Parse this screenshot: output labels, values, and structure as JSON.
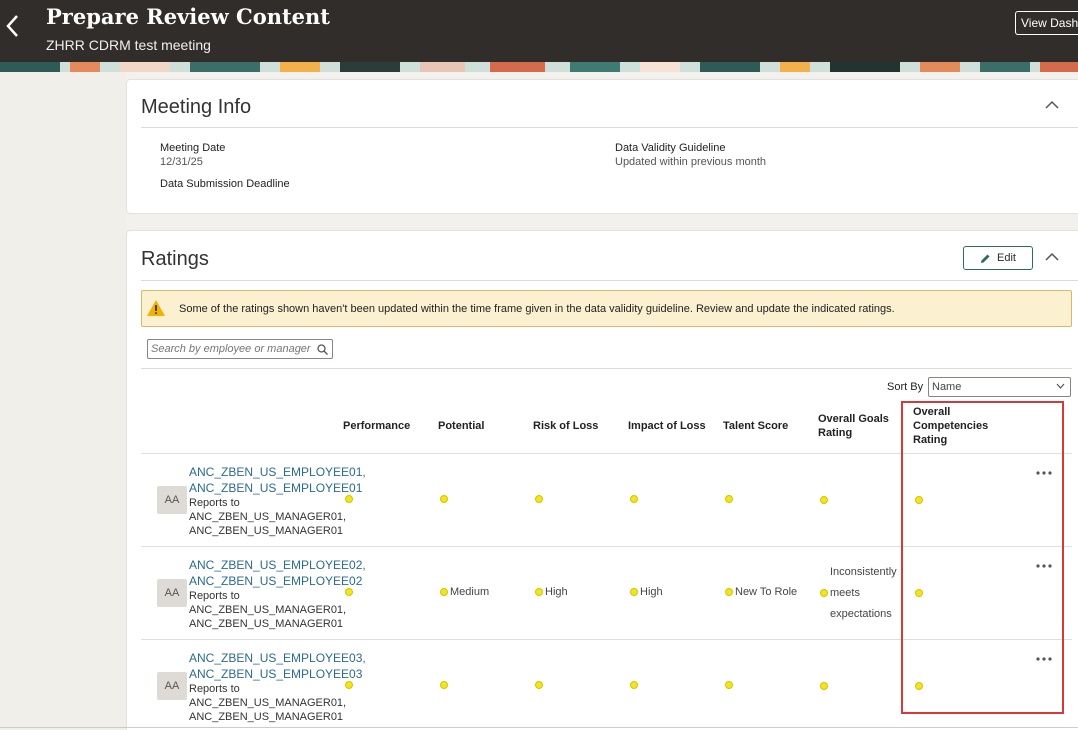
{
  "header": {
    "title": "Prepare Review Content",
    "subtitle": "ZHRR CDRM test meeting",
    "view_dashboard_label": "View Dashb"
  },
  "meeting_info": {
    "title": "Meeting Info",
    "meeting_date_label": "Meeting Date",
    "meeting_date_value": "12/31/25",
    "submission_deadline_label": "Data Submission Deadline",
    "validity_label": "Data Validity Guideline",
    "validity_value": "Updated within previous month"
  },
  "ratings": {
    "title": "Ratings",
    "edit_label": "Edit",
    "warning": "Some of the ratings shown haven't been updated within the time frame given in the data validity guideline. Review and update the indicated ratings.",
    "search_placeholder": "Search by employee or manager",
    "sort_by_label": "Sort By",
    "sort_value": "Name",
    "columns": {
      "performance": "Performance",
      "potential": "Potential",
      "risk_of_loss": "Risk of Loss",
      "impact_of_loss": "Impact of Loss",
      "talent_score": "Talent Score",
      "goals_line1": "Overall Goals",
      "goals_line2": "Rating",
      "comp_line1": "Overall",
      "comp_line2": "Competencies",
      "comp_line3": "Rating"
    },
    "rows": [
      {
        "avatar": "AA",
        "name_line1": "ANC_ZBEN_US_EMPLOYEE01,",
        "name_line2": "ANC_ZBEN_US_EMPLOYEE01",
        "reports_line1": "Reports to",
        "reports_line2": "ANC_ZBEN_US_MANAGER01,",
        "reports_line3": "ANC_ZBEN_US_MANAGER01",
        "potential": "",
        "risk": "",
        "impact": "",
        "talent": ""
      },
      {
        "avatar": "AA",
        "name_line1": "ANC_ZBEN_US_EMPLOYEE02,",
        "name_line2": "ANC_ZBEN_US_EMPLOYEE02",
        "reports_line1": "Reports to",
        "reports_line2": "ANC_ZBEN_US_MANAGER01,",
        "reports_line3": "ANC_ZBEN_US_MANAGER01",
        "potential": "Medium",
        "risk": "High",
        "impact": "High",
        "talent": "New To Role",
        "goals_line1": "Inconsistently",
        "goals_line2": "meets",
        "goals_line3": "expectations"
      },
      {
        "avatar": "AA",
        "name_line1": "ANC_ZBEN_US_EMPLOYEE03,",
        "name_line2": "ANC_ZBEN_US_EMPLOYEE03",
        "reports_line1": "Reports to",
        "reports_line2": "ANC_ZBEN_US_MANAGER01,",
        "reports_line3": "ANC_ZBEN_US_MANAGER01",
        "potential": "",
        "risk": "",
        "impact": "",
        "talent": ""
      }
    ]
  },
  "colors": {
    "header_bg": "#312d2a",
    "link": "#2b6b8c",
    "indicator_dot": "#f1e51c",
    "highlight": "#d53a3a",
    "warning_bg": "#fbf0d0"
  }
}
